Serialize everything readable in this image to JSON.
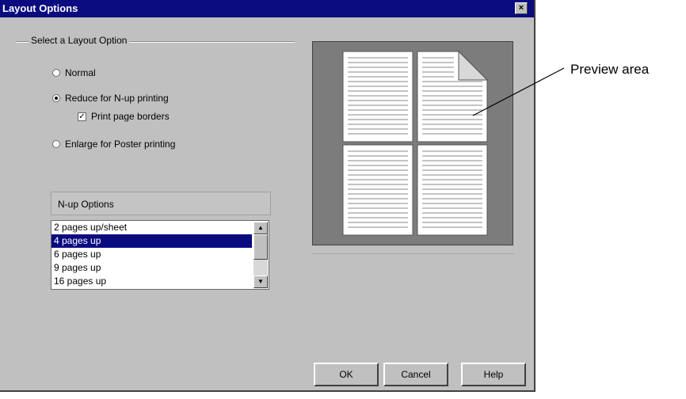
{
  "dialog": {
    "title": "Layout Options",
    "close_label": "×"
  },
  "layout_group": {
    "label": "Select a Layout Option",
    "options": [
      {
        "label": "Normal",
        "checked": false
      },
      {
        "label": "Reduce for N-up printing",
        "checked": true
      },
      {
        "label": "Enlarge for Poster printing",
        "checked": false
      }
    ],
    "print_borders": {
      "label": "Print page borders",
      "checked": true
    }
  },
  "nup": {
    "header": "N-up Options",
    "items": [
      "2 pages up/sheet",
      "4 pages up",
      "6 pages up",
      "9 pages up",
      "16 pages up"
    ],
    "selected_index": 1
  },
  "buttons": {
    "ok": "OK",
    "cancel": "Cancel",
    "help": "Help"
  },
  "annotation": {
    "label": "Preview area"
  }
}
